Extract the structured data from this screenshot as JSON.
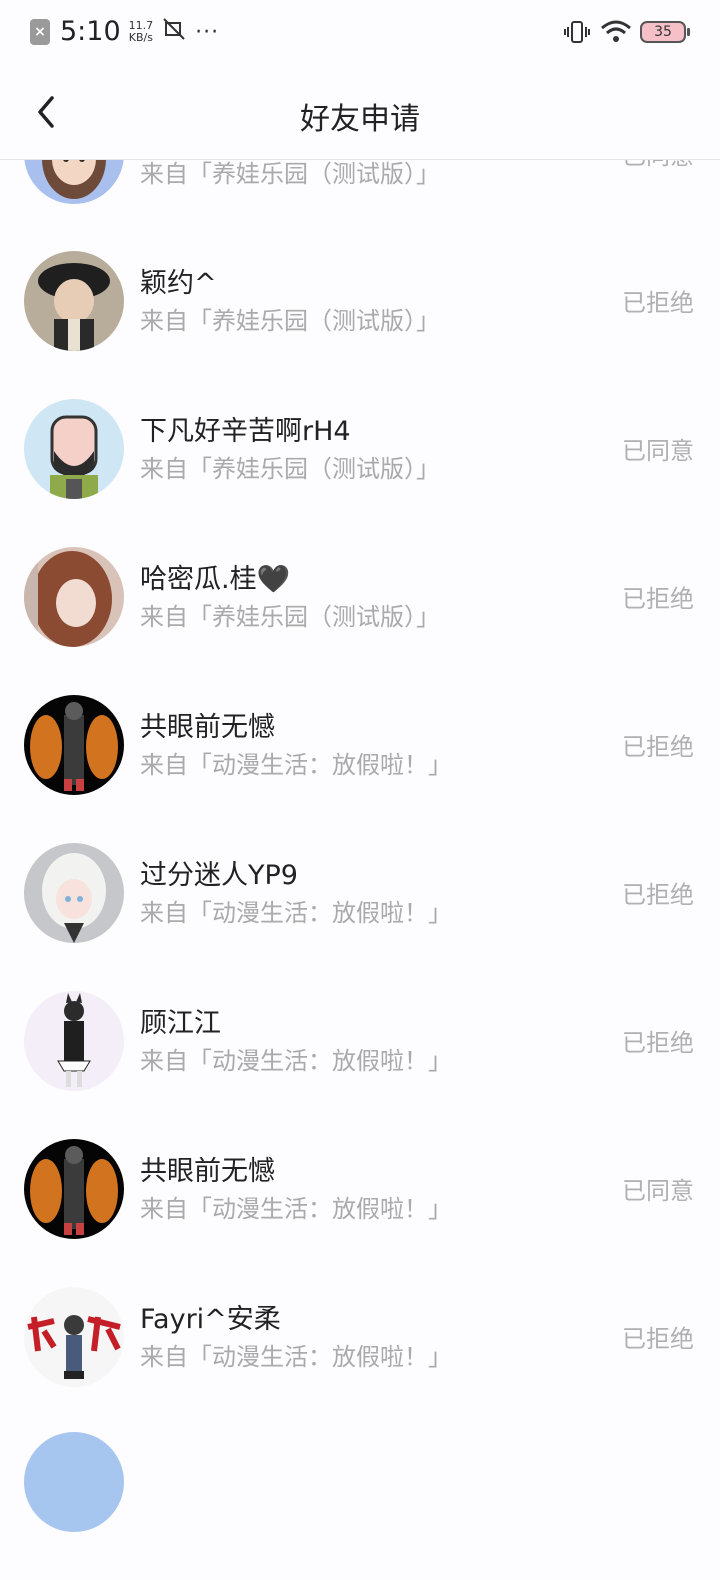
{
  "status_bar": {
    "time": "5:10",
    "speed_value": "11.7",
    "speed_unit": "KB/s",
    "battery": "35"
  },
  "header": {
    "title": "好友申请"
  },
  "requests": [
    {
      "name": "",
      "source": "来自「养娃乐园（测试版）」",
      "status": "已同意",
      "avatar": "female-brown-hair-avatar"
    },
    {
      "name": "颖约^",
      "source": "来自「养娃乐园（测试版）」",
      "status": "已拒绝",
      "avatar": "male-dark-hat-avatar"
    },
    {
      "name": "下凡好辛苦啊rH4",
      "source": "来自「养娃乐园（测试版）」",
      "status": "已同意",
      "avatar": "bearded-cartoon-avatar"
    },
    {
      "name": "哈密瓜.桂🖤",
      "source": "来自「养娃乐园（测试版）」",
      "status": "已拒绝",
      "avatar": "girl-photo-avatar"
    },
    {
      "name": "共眼前无憾",
      "source": "来自「动漫生活：放假啦！」",
      "status": "已拒绝",
      "avatar": "fox-tail-character-avatar"
    },
    {
      "name": "过分迷人YP9",
      "source": "来自「动漫生活：放假啦！」",
      "status": "已拒绝",
      "avatar": "white-hair-girl-avatar"
    },
    {
      "name": "顾江江",
      "source": "来自「动漫生活：放假啦！」",
      "status": "已拒绝",
      "avatar": "cat-ear-girl-avatar"
    },
    {
      "name": "共眼前无憾",
      "source": "来自「动漫生活：放假啦！」",
      "status": "已同意",
      "avatar": "fox-tail-character-avatar"
    },
    {
      "name": "Fayri^安柔",
      "source": "来自「动漫生活：放假啦！」",
      "status": "已拒绝",
      "avatar": "calligraphy-character-avatar"
    }
  ]
}
